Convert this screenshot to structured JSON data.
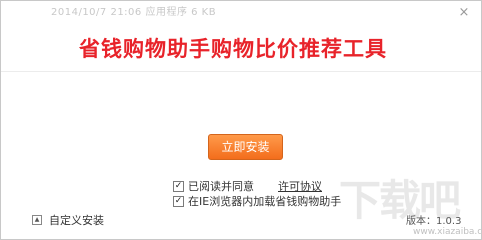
{
  "app": {
    "background_text": "2014/10/7 21:06    应用程序        6 KB",
    "banner_title": "省钱购物助手购物比价推荐工具",
    "title_color": "#e8232a",
    "accent_color": "#f36d1c"
  },
  "window_controls": {
    "close_icon": "×"
  },
  "main": {
    "install_button_label": "立即安装",
    "agree_checkbox": {
      "checked": true,
      "mark": "✓",
      "label": "已阅读并同意",
      "link_label": "许可协议"
    },
    "ie_checkbox": {
      "checked": true,
      "mark": "✓",
      "label": "在IE浏览器内加载省钱购物助手"
    }
  },
  "footer": {
    "custom_install_icon": "▲",
    "custom_install_label": "自定义安装",
    "version_label": "版本：",
    "version_value": "1.0.3"
  },
  "watermark": {
    "logo_text": "下载吧",
    "url": "www.xiazaiba.com"
  }
}
